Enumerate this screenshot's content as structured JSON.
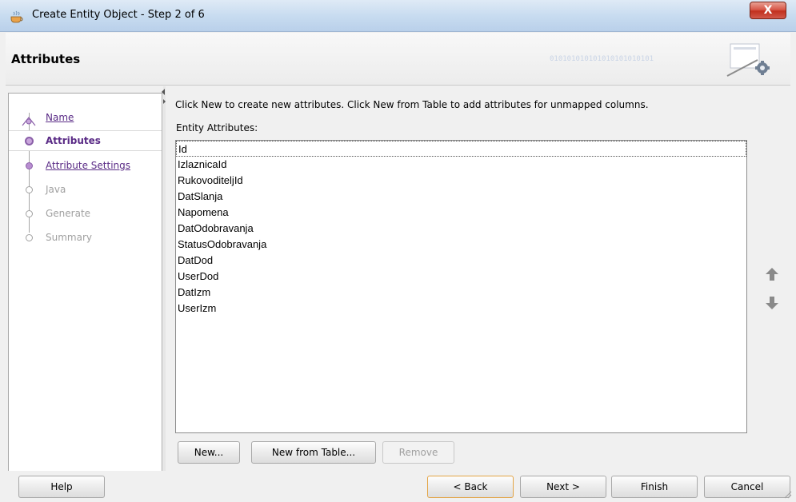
{
  "window": {
    "title": "Create Entity Object - Step 2 of 6",
    "close_label": "X"
  },
  "header": {
    "title": "Attributes",
    "binary_text": "010101010101010101010101"
  },
  "nav": {
    "items": [
      {
        "label": "Name",
        "state": "link"
      },
      {
        "label": "Attributes",
        "state": "current"
      },
      {
        "label": "Attribute Settings",
        "state": "link"
      },
      {
        "label": "Java",
        "state": "disabled"
      },
      {
        "label": "Generate",
        "state": "disabled"
      },
      {
        "label": "Summary",
        "state": "disabled"
      }
    ]
  },
  "main": {
    "instruction": "Click New to create new attributes.  Click New from Table to add attributes for unmapped columns.",
    "list_label": "Entity Attributes:",
    "attributes": [
      "Id",
      "IzlaznicaId",
      "RukovoditeljId",
      "DatSlanja",
      "Napomena",
      "DatOdobravanja",
      "StatusOdobravanja",
      "DatDod",
      "UserDod",
      "DatIzm",
      "UserIzm"
    ],
    "buttons": {
      "new": "New...",
      "new_from_table": "New from Table...",
      "remove": "Remove"
    }
  },
  "footer": {
    "help": "Help",
    "back": "< Back",
    "next": "Next >",
    "finish": "Finish",
    "cancel": "Cancel"
  },
  "colors": {
    "accent_purple": "#5a2b86",
    "default_button_border": "#e3a445"
  }
}
